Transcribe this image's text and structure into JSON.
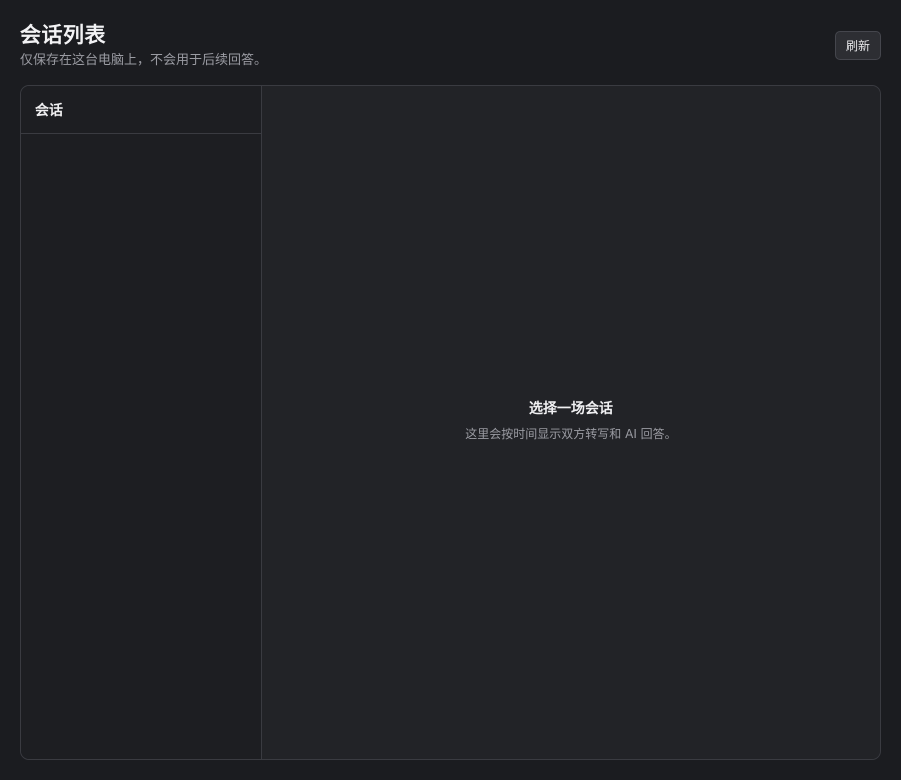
{
  "header": {
    "title": "会话列表",
    "subtitle": "仅保存在这台电脑上，不会用于后续回答。",
    "refresh_label": "刷新"
  },
  "sidebar": {
    "title": "会话",
    "sessions": []
  },
  "detail": {
    "empty_title": "选择一场会话",
    "empty_description": "这里会按时间显示双方转写和 AI 回答。"
  }
}
